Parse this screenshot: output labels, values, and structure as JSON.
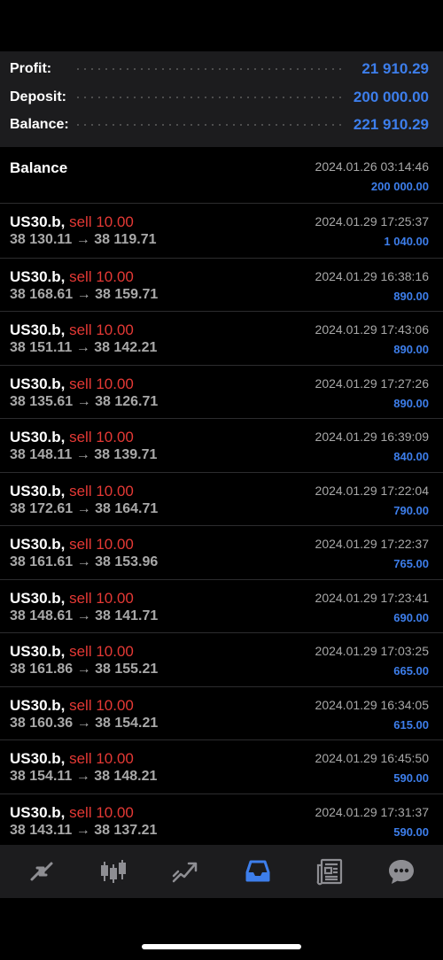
{
  "summary": {
    "profit_label": "Profit:",
    "profit_value": "21 910.29",
    "deposit_label": "Deposit:",
    "deposit_value": "200 000.00",
    "balance_label": "Balance:",
    "balance_value": "221 910.29"
  },
  "balance_entry": {
    "title": "Balance",
    "time": "2024.01.26 03:14:46",
    "amount": "200 000.00"
  },
  "deals": [
    {
      "symbol": "US30.b,",
      "side": "sell 10.00",
      "prices": "38 130.11 → 38 119.71",
      "time": "2024.01.29 17:25:37",
      "profit": "1 040.00"
    },
    {
      "symbol": "US30.b,",
      "side": "sell 10.00",
      "prices": "38 168.61 → 38 159.71",
      "time": "2024.01.29 16:38:16",
      "profit": "890.00"
    },
    {
      "symbol": "US30.b,",
      "side": "sell 10.00",
      "prices": "38 151.11 → 38 142.21",
      "time": "2024.01.29 17:43:06",
      "profit": "890.00"
    },
    {
      "symbol": "US30.b,",
      "side": "sell 10.00",
      "prices": "38 135.61 → 38 126.71",
      "time": "2024.01.29 17:27:26",
      "profit": "890.00"
    },
    {
      "symbol": "US30.b,",
      "side": "sell 10.00",
      "prices": "38 148.11 → 38 139.71",
      "time": "2024.01.29 16:39:09",
      "profit": "840.00"
    },
    {
      "symbol": "US30.b,",
      "side": "sell 10.00",
      "prices": "38 172.61 → 38 164.71",
      "time": "2024.01.29 17:22:04",
      "profit": "790.00"
    },
    {
      "symbol": "US30.b,",
      "side": "sell 10.00",
      "prices": "38 161.61 → 38 153.96",
      "time": "2024.01.29 17:22:37",
      "profit": "765.00"
    },
    {
      "symbol": "US30.b,",
      "side": "sell 10.00",
      "prices": "38 148.61 → 38 141.71",
      "time": "2024.01.29 17:23:41",
      "profit": "690.00"
    },
    {
      "symbol": "US30.b,",
      "side": "sell 10.00",
      "prices": "38 161.86 → 38 155.21",
      "time": "2024.01.29 17:03:25",
      "profit": "665.00"
    },
    {
      "symbol": "US30.b,",
      "side": "sell 10.00",
      "prices": "38 160.36 → 38 154.21",
      "time": "2024.01.29 16:34:05",
      "profit": "615.00"
    },
    {
      "symbol": "US30.b,",
      "side": "sell 10.00",
      "prices": "38 154.11 → 38 148.21",
      "time": "2024.01.29 16:45:50",
      "profit": "590.00"
    },
    {
      "symbol": "US30.b,",
      "side": "sell 10.00",
      "prices": "38 143.11 → 38 137.21",
      "time": "2024.01.29 17:31:37",
      "profit": "590.00"
    }
  ],
  "tabbar": {
    "items": [
      {
        "icon": "quotes-arrows-icon",
        "active": false
      },
      {
        "icon": "candlestick-chart-icon",
        "active": false
      },
      {
        "icon": "trade-chart-icon",
        "active": false
      },
      {
        "icon": "history-inbox-icon",
        "active": true
      },
      {
        "icon": "news-icon",
        "active": false
      },
      {
        "icon": "messages-icon",
        "active": false
      }
    ]
  },
  "colors": {
    "accent": "#3d7eeb",
    "sell": "#e53935",
    "background": "#000000",
    "panel": "#1c1c1e",
    "icon_inactive": "#8e8e93"
  }
}
